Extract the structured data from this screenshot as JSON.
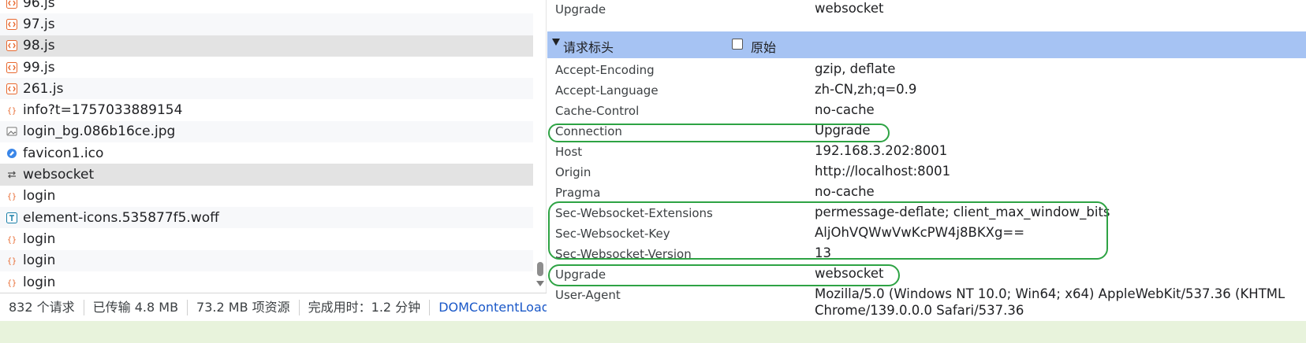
{
  "request_list": {
    "items": [
      {
        "name": "96.js",
        "icon": "script-icon"
      },
      {
        "name": "97.js",
        "icon": "script-icon"
      },
      {
        "name": "98.js",
        "icon": "script-icon"
      },
      {
        "name": "99.js",
        "icon": "script-icon"
      },
      {
        "name": "261.js",
        "icon": "script-icon"
      },
      {
        "name": "info?t=1757033889154",
        "icon": "fetch-icon"
      },
      {
        "name": "login_bg.086b16ce.jpg",
        "icon": "image-icon"
      },
      {
        "name": "favicon1.ico",
        "icon": "favicon-icon"
      },
      {
        "name": "websocket",
        "icon": "websocket-icon"
      },
      {
        "name": "login",
        "icon": "fetch-icon"
      },
      {
        "name": "element-icons.535877f5.woff",
        "icon": "font-icon"
      },
      {
        "name": "login",
        "icon": "fetch-icon"
      },
      {
        "name": "login",
        "icon": "fetch-icon"
      },
      {
        "name": "login",
        "icon": "fetch-icon"
      }
    ],
    "selected_item": "websocket"
  },
  "status_bar": {
    "requests": "832 个请求",
    "transferred": "已传输 4.8 MB",
    "resources": "73.2 MB 项资源",
    "finish": "完成用时：1.2 分钟",
    "dcl": "DOMContentLoaded"
  },
  "response_headers_tail": {
    "name": "Upgrade",
    "value": "websocket"
  },
  "request_headers_section": {
    "title": "请求标头",
    "raw_label": "原始",
    "raw_checked": false
  },
  "request_headers": [
    {
      "name": "Accept-Encoding",
      "value": "gzip, deflate"
    },
    {
      "name": "Accept-Language",
      "value": "zh-CN,zh;q=0.9"
    },
    {
      "name": "Cache-Control",
      "value": "no-cache"
    },
    {
      "name": "Connection",
      "value": "Upgrade"
    },
    {
      "name": "Host",
      "value": "192.168.3.202:8001"
    },
    {
      "name": "Origin",
      "value": "http://localhost:8001"
    },
    {
      "name": "Pragma",
      "value": "no-cache"
    },
    {
      "name": "Sec-Websocket-Extensions",
      "value": "permessage-deflate; client_max_window_bits"
    },
    {
      "name": "Sec-Websocket-Key",
      "value": "AljOhVQWwVwKcPW4j8BKXg=="
    },
    {
      "name": "Sec-Websocket-Version",
      "value": "13"
    },
    {
      "name": "Upgrade",
      "value": "websocket"
    },
    {
      "name": "User-Agent",
      "value": "Mozilla/5.0 (Windows NT 10.0; Win64; x64) AppleWebKit/537.36 (KHTML"
    },
    {
      "name": "",
      "value": "Chrome/139.0.0.0 Safari/537.36"
    }
  ],
  "colors": {
    "highlight": "#2ea344",
    "section_bar": "#a6c3f3",
    "selected_row": "#e3e3e3",
    "link": "#1a58c8",
    "script_icon": "#e8692f",
    "bottom_strip": "#e8f3dc"
  }
}
